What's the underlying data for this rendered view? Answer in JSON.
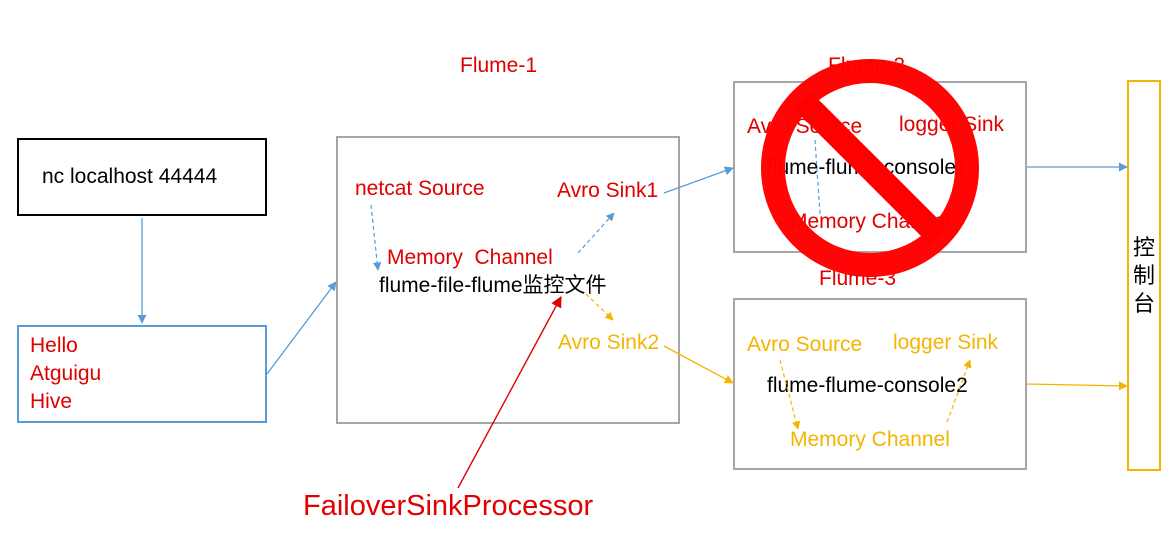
{
  "colors": {
    "red": "#e00000",
    "orange": "#f5b400",
    "blue": "#5b9bd5",
    "gray": "#a6a6a6",
    "black": "#000000"
  },
  "nc_box": {
    "label": "nc localhost 44444"
  },
  "input_box": {
    "lines": [
      "Hello",
      "Atguigu",
      "Hive"
    ]
  },
  "flume1": {
    "title": "Flume-1",
    "source": "netcat Source",
    "channel": "Memory  Channel",
    "config": "flume-file-flume监控文件",
    "sink1": "Avro Sink1",
    "sink2": "Avro Sink2"
  },
  "flume2": {
    "title": "Flume-2",
    "source": "Avro Source",
    "sink": "logger Sink",
    "config": "flume-flume-console1",
    "channel": "Memory Channel",
    "overlay_icon": "prohibited-icon"
  },
  "flume3": {
    "title": "Flume-3",
    "source": "Avro Source",
    "sink": "logger Sink",
    "config": "flume-flume-console2",
    "channel": "Memory Channel"
  },
  "console_box": {
    "label": "控制台"
  },
  "processor_label": "FailoverSinkProcessor"
}
